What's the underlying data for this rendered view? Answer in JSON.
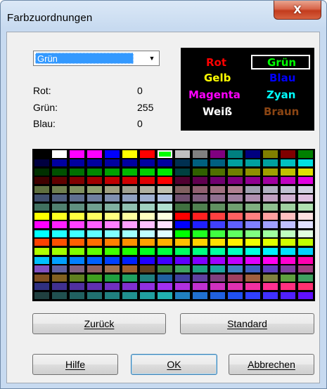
{
  "window": {
    "title": "Farbzuordnungen",
    "close_glyph": "X"
  },
  "color_select": {
    "value": "Grün",
    "arrow": "▼"
  },
  "rgb": {
    "red_label": "Rot:",
    "red_value": "0",
    "green_label": "Grün:",
    "green_value": "255",
    "blue_label": "Blau:",
    "blue_value": "0"
  },
  "preview": [
    {
      "name": "Rot",
      "color": "#ff0000"
    },
    {
      "name": "Grün",
      "color": "#00ff00"
    },
    {
      "name": "Gelb",
      "color": "#ffff00"
    },
    {
      "name": "Blau",
      "color": "#0000ff"
    },
    {
      "name": "Magenta",
      "color": "#ff00ff"
    },
    {
      "name": "Zyan",
      "color": "#00ffff"
    },
    {
      "name": "Weiß",
      "color": "#ffffff"
    },
    {
      "name": "Braun",
      "color": "#8b4513"
    }
  ],
  "palette": {
    "selected": [
      0,
      8
    ],
    "rows": [
      [
        "#000000",
        "#ffffff",
        "#ff00ff",
        "#ff00ff",
        "#0000ff",
        "#ffff00",
        "#ff0000",
        "#00ff00",
        "#c0c0c0",
        "#808080",
        "#800080",
        "#008080",
        "#000080",
        "#808000",
        "#800000",
        "#008000"
      ],
      [
        "#000040",
        "#0000a0",
        "#0000a0",
        "#0000a0",
        "#0000a0",
        "#0000a0",
        "#0000a0",
        "#0000a0",
        "#003050",
        "#006080",
        "#006080",
        "#00a0a0",
        "#00a0a0",
        "#00a0a0",
        "#00c0c0",
        "#00e0e0"
      ],
      [
        "#003000",
        "#005000",
        "#007000",
        "#008800",
        "#00a000",
        "#00b800",
        "#00d000",
        "#00e800",
        "#004040",
        "#306000",
        "#507000",
        "#708000",
        "#909000",
        "#a0a000",
        "#c0c000",
        "#e0e000"
      ],
      [
        "#400000",
        "#600000",
        "#800000",
        "#a00000",
        "#c00000",
        "#d00000",
        "#e00000",
        "#ff0000",
        "#500030",
        "#600050",
        "#700070",
        "#800080",
        "#900090",
        "#a000a0",
        "#c000c0",
        "#e000e0"
      ],
      [
        "#607040",
        "#708050",
        "#809060",
        "#90a070",
        "#a0a080",
        "#a0a090",
        "#b0b0a0",
        "#c0c0b0",
        "#806060",
        "#906070",
        "#a07080",
        "#b08090",
        "#a0a0b0",
        "#b0b0c0",
        "#c0c0d0",
        "#d0d0e0"
      ],
      [
        "#405070",
        "#506080",
        "#607090",
        "#7080a0",
        "#8090b0",
        "#90a0c0",
        "#a0b0d0",
        "#b0c0e0",
        "#705070",
        "#806080",
        "#907090",
        "#a080a0",
        "#b090b0",
        "#c0a0c0",
        "#d0b0d0",
        "#e0c0e0"
      ],
      [
        "#407060",
        "#508070",
        "#609080",
        "#70a090",
        "#80b0a0",
        "#90c0b0",
        "#a0d0c0",
        "#b0e0d0",
        "#407040",
        "#508050",
        "#609060",
        "#70a070",
        "#80b080",
        "#90c090",
        "#a0d0a0",
        "#b0e0b0"
      ],
      [
        "#ffff00",
        "#ffff20",
        "#ffff40",
        "#ffff60",
        "#ffff80",
        "#ffffa0",
        "#ffffc0",
        "#ffffe0",
        "#ff0000",
        "#ff2020",
        "#ff4040",
        "#ff6060",
        "#ff8080",
        "#ffa0a0",
        "#ffc0c0",
        "#ffe0e0"
      ],
      [
        "#ff00ff",
        "#ff20ff",
        "#ff40ff",
        "#ff60ff",
        "#ff80ff",
        "#ffa0ff",
        "#ffc0ff",
        "#ffe0ff",
        "#0000ff",
        "#2020ff",
        "#4040ff",
        "#6060ff",
        "#8080ff",
        "#a0a0ff",
        "#c0c0ff",
        "#e0e0ff"
      ],
      [
        "#00ffff",
        "#20ffff",
        "#40ffff",
        "#60ffff",
        "#80ffff",
        "#a0ffff",
        "#c0ffff",
        "#e0ffff",
        "#00ff00",
        "#20ff20",
        "#40ff40",
        "#60ff60",
        "#80ff80",
        "#a0ffa0",
        "#c0ffc0",
        "#e0ffe0"
      ],
      [
        "#ff4000",
        "#ff5000",
        "#ff6000",
        "#ff7000",
        "#ff8000",
        "#ff9000",
        "#ffa000",
        "#ffb000",
        "#ffc000",
        "#ffd000",
        "#ffe000",
        "#fff000",
        "#f0ff00",
        "#e0ff00",
        "#d0ff00",
        "#c0ff00"
      ],
      [
        "#b0ff00",
        "#a0ff00",
        "#80ff00",
        "#60ff00",
        "#40ff00",
        "#20ff00",
        "#00ff20",
        "#00ff40",
        "#00ff60",
        "#00ff80",
        "#00ffa0",
        "#00ffc0",
        "#00ffe0",
        "#00f0ff",
        "#00e0ff",
        "#00d0ff"
      ],
      [
        "#00c0ff",
        "#00a0ff",
        "#0080ff",
        "#0060ff",
        "#0040ff",
        "#0020ff",
        "#2000ff",
        "#4000ff",
        "#6000ff",
        "#8000ff",
        "#a000ff",
        "#c000ff",
        "#e000ff",
        "#ff00f0",
        "#ff00d0",
        "#ff00b0"
      ],
      [
        "#8050c0",
        "#6060a0",
        "#806080",
        "#906060",
        "#a07050",
        "#a06030",
        "#604020",
        "#408040",
        "#40a060",
        "#20a080",
        "#20a0a0",
        "#4080c0",
        "#4060c0",
        "#6040c0",
        "#8040a0",
        "#a04080"
      ],
      [
        "#805020",
        "#806020",
        "#608020",
        "#40a020",
        "#20a040",
        "#20a060",
        "#208080",
        "#2060a0",
        "#4040a0",
        "#6040a0",
        "#804080",
        "#a04060",
        "#a06040",
        "#808040",
        "#60a040",
        "#40a060"
      ],
      [
        "#303080",
        "#403090",
        "#5030a0",
        "#6030b0",
        "#7030c0",
        "#8030d0",
        "#9030e0",
        "#a030f0",
        "#b030e0",
        "#c030d0",
        "#d030c0",
        "#e030b0",
        "#f030a0",
        "#ff3090",
        "#ff3080",
        "#ff3070"
      ],
      [
        "#204040",
        "#205050",
        "#206060",
        "#207070",
        "#208080",
        "#209090",
        "#20a0a0",
        "#20b0b0",
        "#2080c0",
        "#2070d0",
        "#2060e0",
        "#2050f0",
        "#3040ff",
        "#4030ff",
        "#5020ff",
        "#6010ff"
      ]
    ]
  },
  "buttons": {
    "back": "Zurück",
    "standard": "Standard",
    "help": "Hilfe",
    "ok": "OK",
    "cancel": "Abbrechen"
  }
}
